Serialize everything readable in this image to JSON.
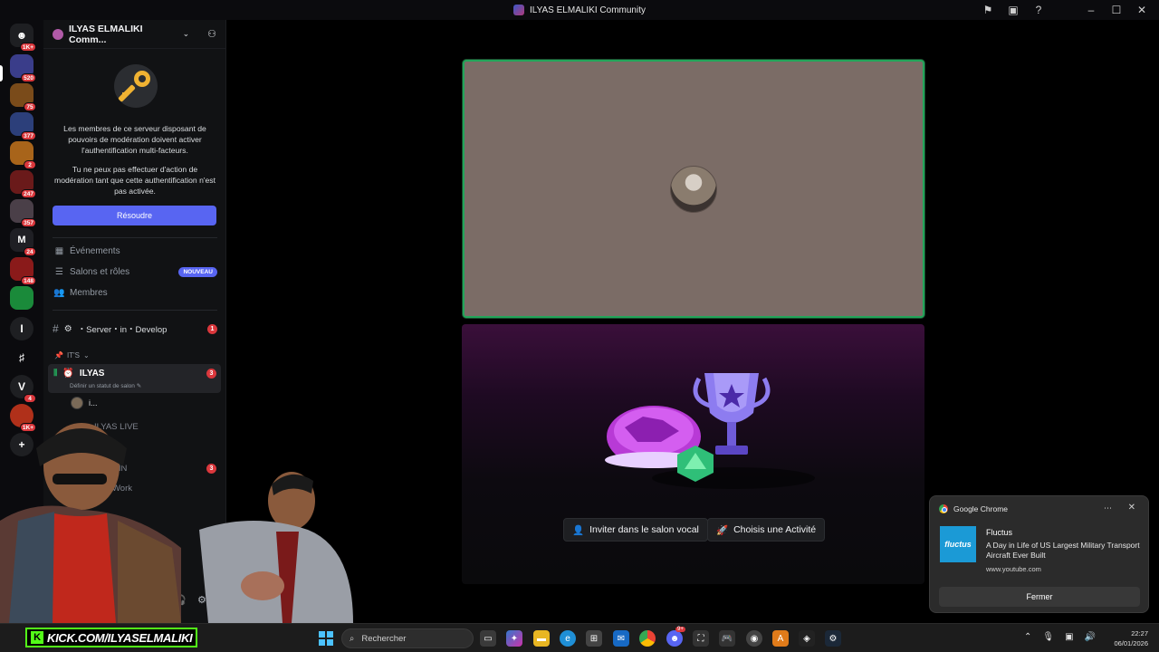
{
  "window": {
    "title": "ILYAS ELMALIKI Community"
  },
  "rail": {
    "badges": [
      "1K+",
      "520",
      "75",
      "377",
      "2",
      "247",
      "357",
      "24",
      "148",
      "4",
      "1K+"
    ],
    "letters": [
      "I",
      "V"
    ]
  },
  "guild": {
    "name": "ILYAS ELMALIKI Comm..."
  },
  "mfa": {
    "line1": "Les membres de ce serveur disposant de pouvoirs de modération doivent activer l'authentification multi-facteurs.",
    "line2": "Tu ne peux pas effectuer d'action de modération tant que cette authentification n'est pas activée.",
    "resolve": "Résoudre"
  },
  "nav": {
    "events": "Événements",
    "channels_roles": "Salons et rôles",
    "new_badge": "NOUVEAU",
    "members": "Membres"
  },
  "channels": {
    "server_dev": "・Server・in・Develop",
    "server_dev_badge": "1",
    "category": "IT'S",
    "voice_name": "ILYAS",
    "voice_badge": "3",
    "voice_status": "Définir un statut de salon",
    "voice_user": "i...",
    "live": "ILYAS LIVE",
    "faded2": "R",
    "faded3": "DIN",
    "faded3_badge": "3",
    "faded4": "Work"
  },
  "activity": {
    "invite": "Inviter dans le salon vocal",
    "choose": "Choisis une Activité"
  },
  "notification": {
    "app": "Google Chrome",
    "thumb_text": "fluctus",
    "title": "Fluctus",
    "body": "A Day in Life of US Largest Military Transport Aircraft Ever Built",
    "site": "www.youtube.com",
    "close_label": "Fermer"
  },
  "taskbar": {
    "kick": "KICK.COM/ILYASELMALIKI",
    "search_placeholder": "Rechercher",
    "discord_badge": "9+",
    "time": "22:27",
    "date": "06/01/2026"
  },
  "colors": {
    "accent": "#5865f2",
    "speaking": "#23a55a",
    "notification_red": "#da373c",
    "kick_green": "#53fc18"
  }
}
